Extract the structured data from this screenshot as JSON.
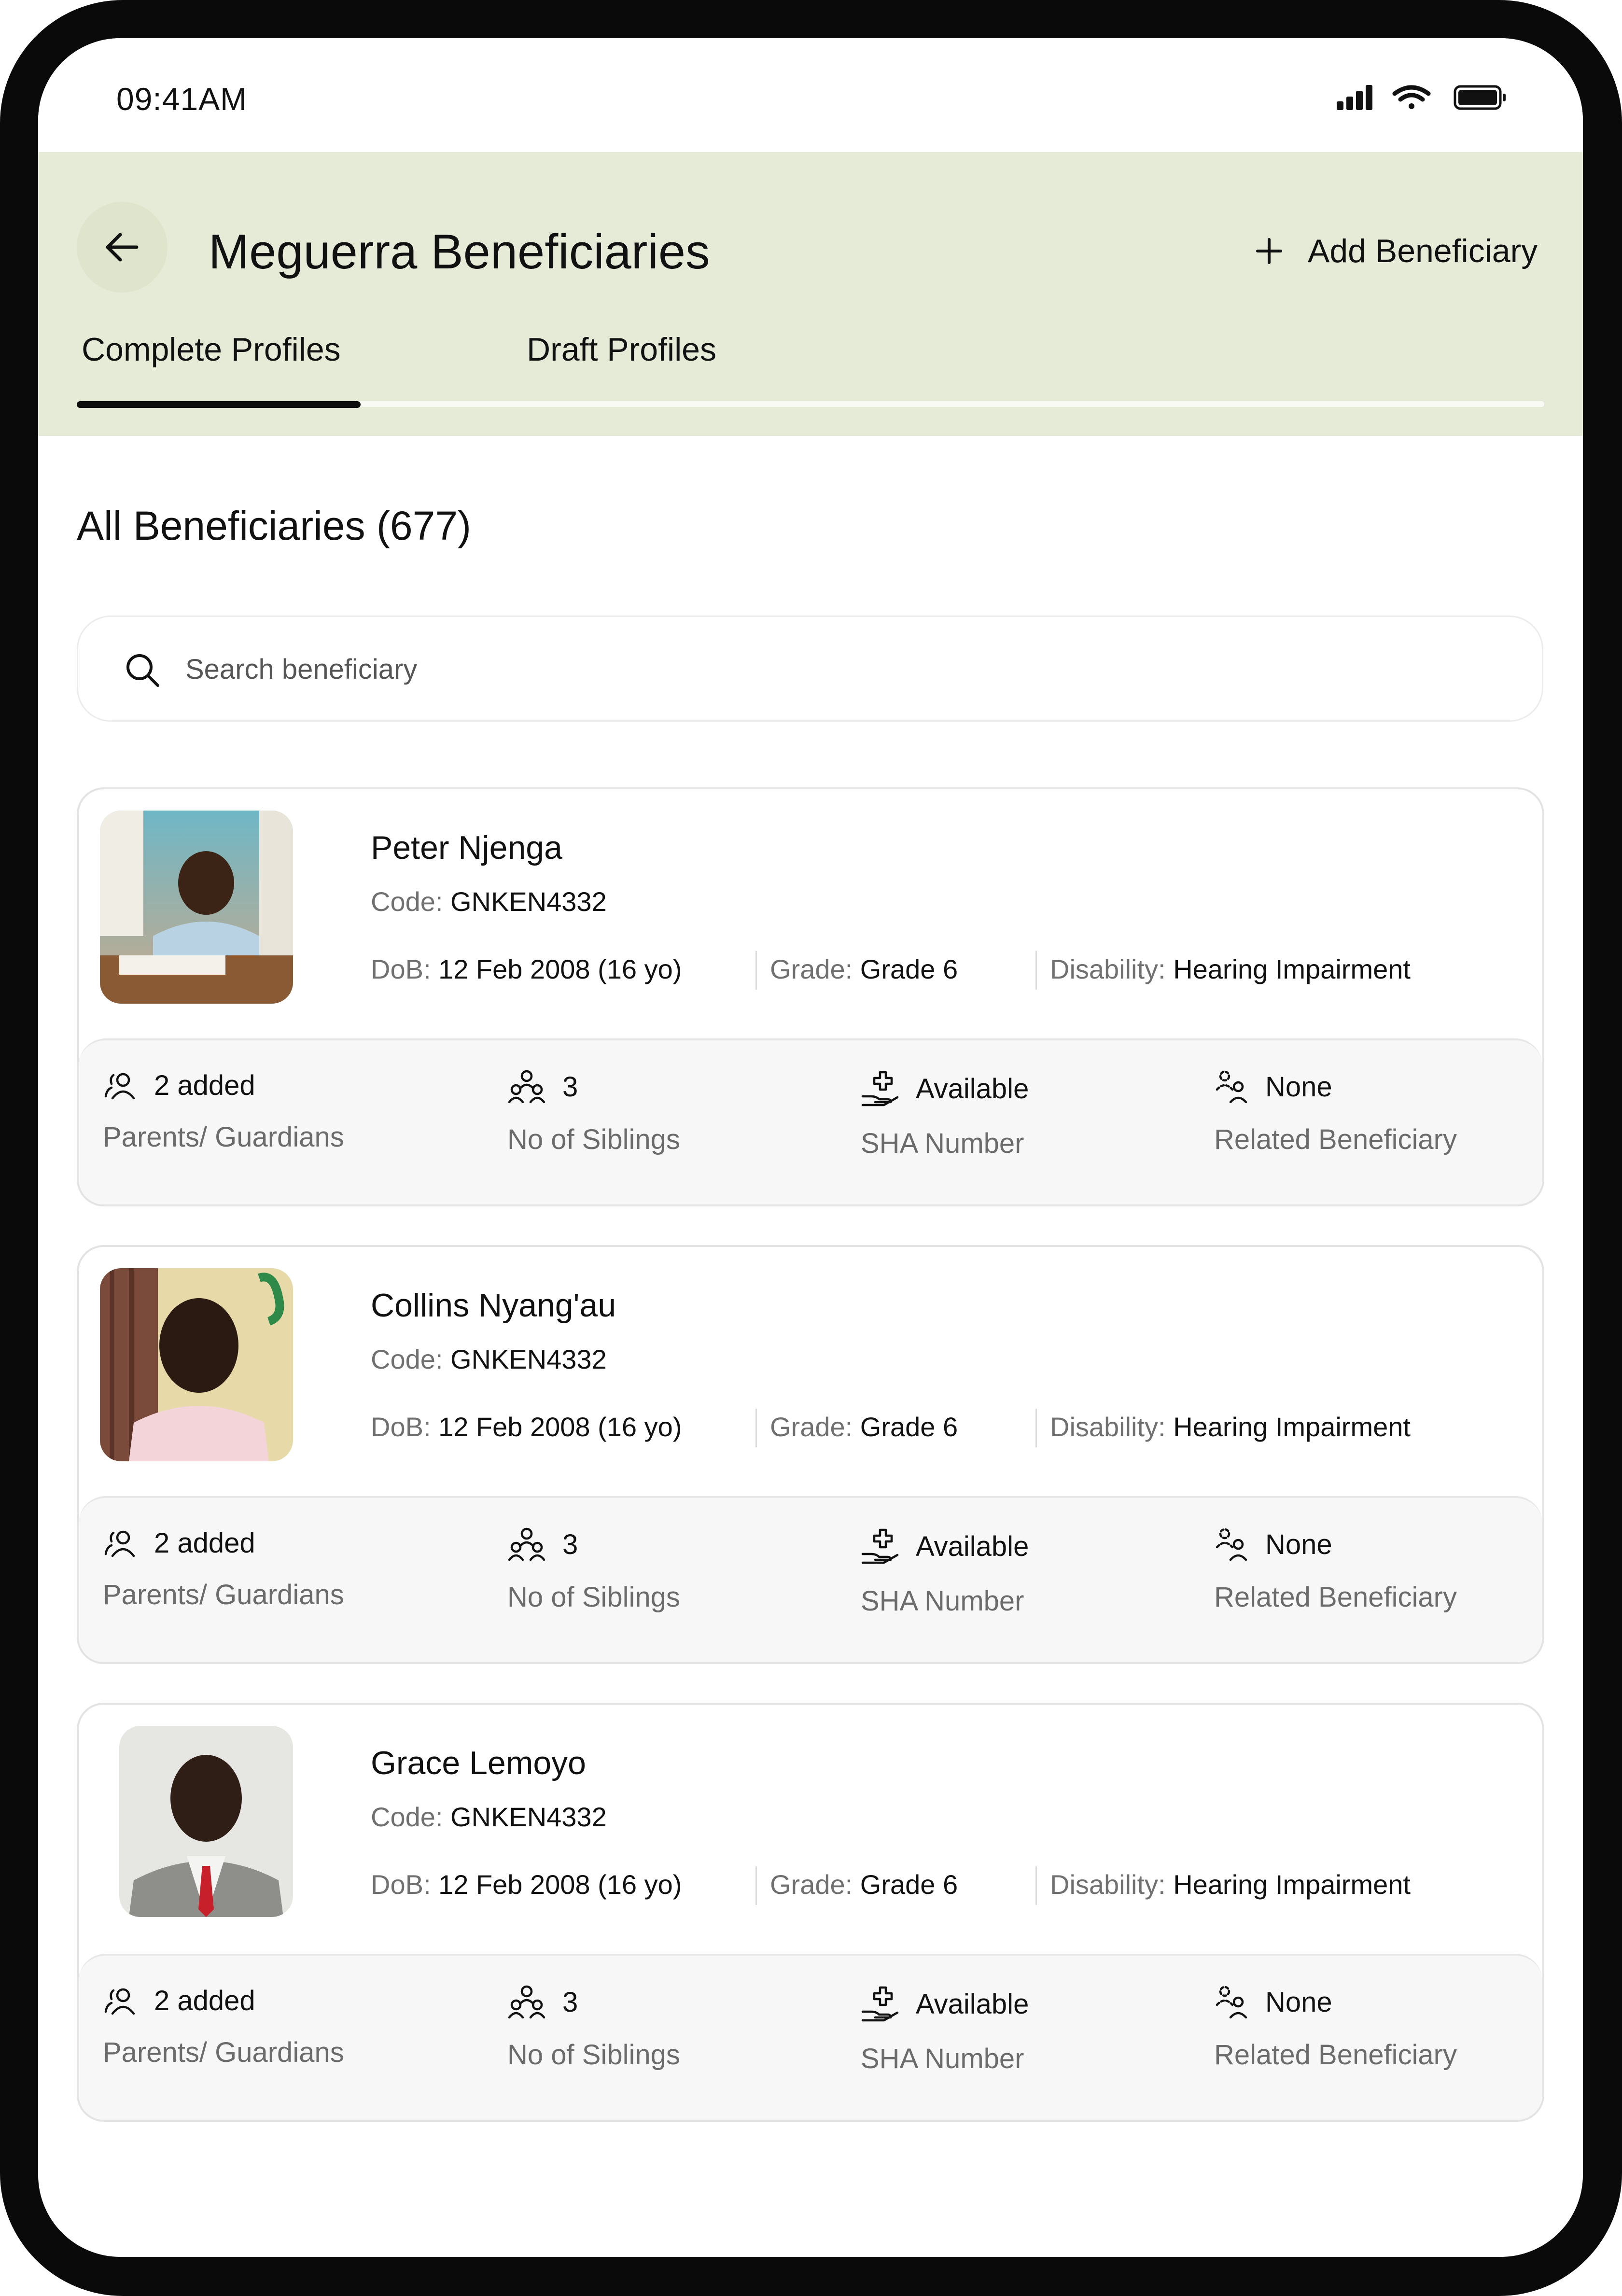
{
  "status_bar": {
    "time": "09:41AM"
  },
  "header": {
    "title": "Meguerra Beneficiaries",
    "add_label": "Add Beneficiary",
    "tabs": [
      {
        "label": "Complete Profiles",
        "active": true
      },
      {
        "label": "Draft Profiles",
        "active": false
      }
    ]
  },
  "section": {
    "title": "All Beneficiaries (677)"
  },
  "search": {
    "placeholder": "Search beneficiary",
    "value": ""
  },
  "labels": {
    "code": "Code:",
    "dob": "DoB:",
    "grade": "Grade:",
    "disability": "Disability:",
    "guardians": "Parents/ Guardians",
    "siblings": "No of Siblings",
    "sha": "SHA Number",
    "related": "Related Beneficiary"
  },
  "beneficiaries": [
    {
      "name": "Peter Njenga",
      "code": "GNKEN4332",
      "dob": "12 Feb 2008 (16 yo)",
      "grade": "Grade 6",
      "disability": "Hearing Impairment",
      "guardians": "2 added",
      "siblings": "3",
      "sha": "Available",
      "related": "None"
    },
    {
      "name": "Collins Nyang'au",
      "code": "GNKEN4332",
      "dob": "12 Feb 2008 (16 yo)",
      "grade": "Grade 6",
      "disability": "Hearing Impairment",
      "guardians": "2 added",
      "siblings": "3",
      "sha": "Available",
      "related": "None"
    },
    {
      "name": "Grace Lemoyo",
      "code": "GNKEN4332",
      "dob": "12 Feb 2008 (16 yo)",
      "grade": "Grade 6",
      "disability": "Hearing Impairment",
      "guardians": "2 added",
      "siblings": "3",
      "sha": "Available",
      "related": "None"
    }
  ],
  "icons": {
    "back": "arrow-left-icon",
    "add": "plus-icon",
    "search": "search-icon",
    "guardians": "users-icon",
    "siblings": "group-icon",
    "sha": "hand-medical-icon",
    "related": "related-users-icon"
  },
  "colors": {
    "header_bg": "#e6ebd7",
    "text": "#111111",
    "muted": "#6b6b6b",
    "tab_indicator": "#0d0d0d"
  }
}
